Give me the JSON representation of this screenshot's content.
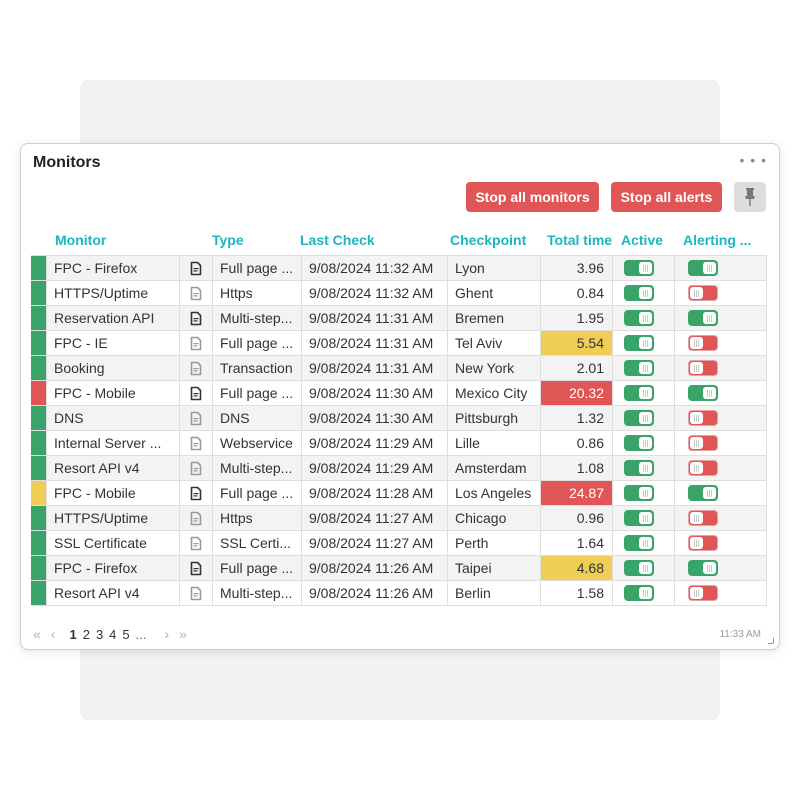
{
  "widget": {
    "title": "Monitors",
    "more_icon": "ellipsis-icon",
    "buttons": {
      "stop_monitors": "Stop all monitors",
      "stop_alerts": "Stop all alerts",
      "pin_icon": "pin-icon"
    },
    "timestamp": "11:33 AM"
  },
  "colors": {
    "accent": "#1ab6c3",
    "ok": "#3aa36a",
    "error": "#e05555",
    "warning": "#f0cd55",
    "icon_dark": "#333333",
    "icon_light": "#9a9a9a"
  },
  "table": {
    "headers": {
      "monitor": "Monitor",
      "type": "Type",
      "last_check": "Last Check",
      "checkpoint": "Checkpoint",
      "total_time": "Total time",
      "active": "Active",
      "alerting": "Alerting ..."
    },
    "rows": [
      {
        "status": "ok",
        "monitor": "FPC - Firefox",
        "icon": "dark",
        "type": "Full page ...",
        "last_check": "9/08/2024 11:32 AM",
        "checkpoint": "Lyon",
        "total_time": "3.96",
        "time_level": "normal",
        "active": true,
        "alerting": true
      },
      {
        "status": "ok",
        "monitor": "HTTPS/Uptime",
        "icon": "light",
        "type": "Https",
        "last_check": "9/08/2024 11:32 AM",
        "checkpoint": "Ghent",
        "total_time": "0.84",
        "time_level": "normal",
        "active": true,
        "alerting": false
      },
      {
        "status": "ok",
        "monitor": "Reservation API",
        "icon": "dark",
        "type": "Multi-step...",
        "last_check": "9/08/2024 11:31 AM",
        "checkpoint": "Bremen",
        "total_time": "1.95",
        "time_level": "normal",
        "active": true,
        "alerting": true
      },
      {
        "status": "ok",
        "monitor": "FPC - IE",
        "icon": "light",
        "type": "Full page ...",
        "last_check": "9/08/2024 11:31 AM",
        "checkpoint": "Tel Aviv",
        "total_time": "5.54",
        "time_level": "warning",
        "active": true,
        "alerting": false
      },
      {
        "status": "ok",
        "monitor": "Booking",
        "icon": "light",
        "type": "Transaction",
        "last_check": "9/08/2024 11:31 AM",
        "checkpoint": "New York",
        "total_time": "2.01",
        "time_level": "normal",
        "active": true,
        "alerting": false
      },
      {
        "status": "error",
        "monitor": "FPC - Mobile",
        "icon": "dark",
        "type": "Full page ...",
        "last_check": "9/08/2024 11:30 AM",
        "checkpoint": "Mexico City",
        "total_time": "20.32",
        "time_level": "error",
        "active": true,
        "alerting": true
      },
      {
        "status": "ok",
        "monitor": "DNS",
        "icon": "light",
        "type": "DNS",
        "last_check": "9/08/2024 11:30 AM",
        "checkpoint": "Pittsburgh",
        "total_time": "1.32",
        "time_level": "normal",
        "active": true,
        "alerting": false
      },
      {
        "status": "ok",
        "monitor": "Internal Server ...",
        "icon": "light",
        "type": "Webservice",
        "last_check": "9/08/2024 11:29 AM",
        "checkpoint": "Lille",
        "total_time": "0.86",
        "time_level": "normal",
        "active": true,
        "alerting": false
      },
      {
        "status": "ok",
        "monitor": "Resort API v4",
        "icon": "light",
        "type": "Multi-step...",
        "last_check": "9/08/2024 11:29 AM",
        "checkpoint": "Amsterdam",
        "total_time": "1.08",
        "time_level": "normal",
        "active": true,
        "alerting": false
      },
      {
        "status": "warning",
        "monitor": "FPC - Mobile",
        "icon": "dark",
        "type": "Full page ...",
        "last_check": "9/08/2024 11:28 AM",
        "checkpoint": "Los Angeles",
        "total_time": "24.87",
        "time_level": "error",
        "active": true,
        "alerting": true
      },
      {
        "status": "ok",
        "monitor": "HTTPS/Uptime",
        "icon": "light",
        "type": "Https",
        "last_check": "9/08/2024 11:27 AM",
        "checkpoint": "Chicago",
        "total_time": "0.96",
        "time_level": "normal",
        "active": true,
        "alerting": false
      },
      {
        "status": "ok",
        "monitor": "SSL Certificate",
        "icon": "light",
        "type": "SSL Certi...",
        "last_check": "9/08/2024 11:27 AM",
        "checkpoint": "Perth",
        "total_time": "1.64",
        "time_level": "normal",
        "active": true,
        "alerting": false
      },
      {
        "status": "ok",
        "monitor": "FPC - Firefox",
        "icon": "dark",
        "type": "Full page ...",
        "last_check": "9/08/2024 11:26 AM",
        "checkpoint": "Taipei",
        "total_time": "4.68",
        "time_level": "warning",
        "active": true,
        "alerting": true
      },
      {
        "status": "ok",
        "monitor": "Resort API v4",
        "icon": "light",
        "type": "Multi-step...",
        "last_check": "9/08/2024 11:26 AM",
        "checkpoint": "Berlin",
        "total_time": "1.58",
        "time_level": "normal",
        "active": true,
        "alerting": false
      }
    ]
  },
  "pagination": {
    "first": "«",
    "prev": "‹",
    "pages": [
      "1",
      "2",
      "3",
      "4",
      "5"
    ],
    "current": "1",
    "ellipsis": "...",
    "next": "›",
    "last": "»"
  }
}
